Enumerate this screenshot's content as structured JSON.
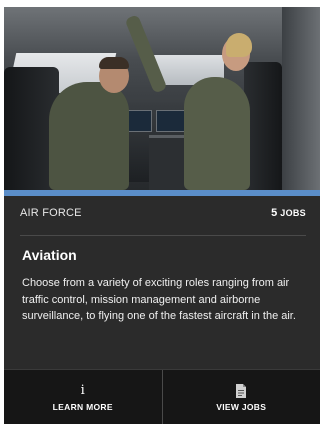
{
  "card": {
    "branch": "AIR FORCE",
    "jobs_count": "5",
    "jobs_label": "JOBS",
    "title": "Aviation",
    "description": "Choose from a variety of exciting roles ranging from air traffic control, mission management and airborne surveillance, to flying one of the fastest aircraft in the air.",
    "accent_color": "#5b8ec9"
  },
  "actions": {
    "learn_more_label": "LEARN MORE",
    "learn_more_icon": "info-icon",
    "view_jobs_label": "VIEW JOBS",
    "view_jobs_icon": "document-icon"
  },
  "image": {
    "subject": "cockpit-photo"
  }
}
